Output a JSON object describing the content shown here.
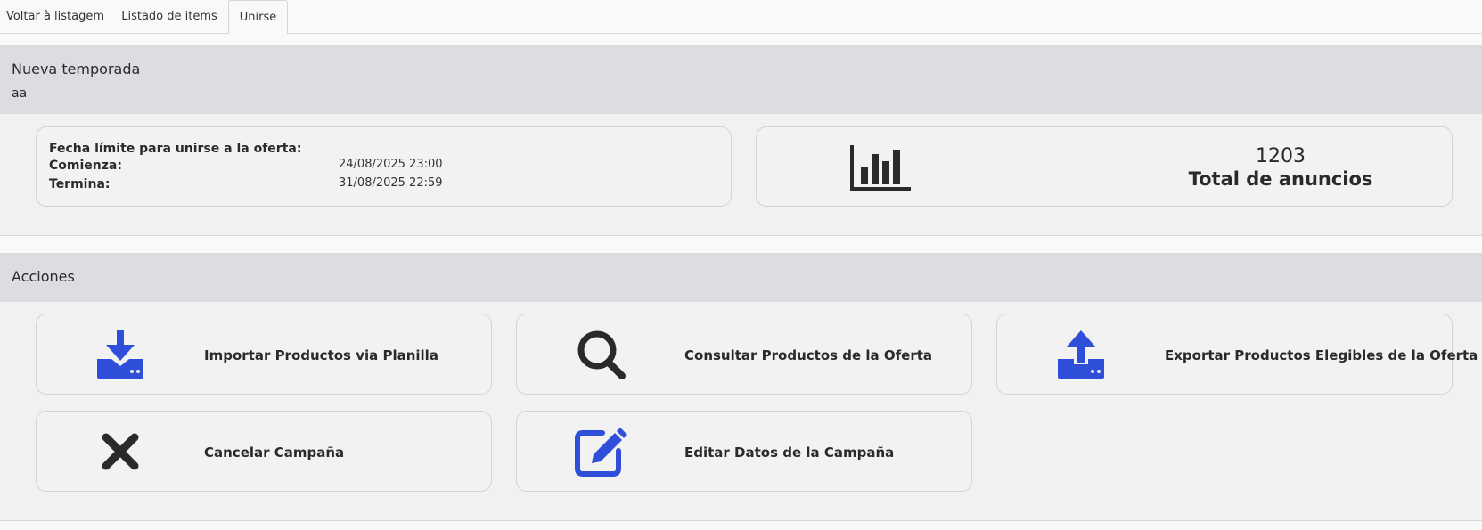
{
  "tabs": [
    {
      "label": "Voltar à listagem"
    },
    {
      "label": "Listado de items"
    },
    {
      "label": "Unirse"
    }
  ],
  "campaign": {
    "title": "Nueva temporada",
    "subtitle": "aa"
  },
  "dates": {
    "deadline_label": "Fecha límite para unirse a la oferta:",
    "start_label": "Comienza:",
    "start_value": "24/08/2025 23:00",
    "end_label": "Termina:",
    "end_value": "31/08/2025 22:59"
  },
  "stats": {
    "total_value": "1203",
    "total_label": "Total de anuncios",
    "icon": "bar-chart-icon"
  },
  "actions_section": {
    "title": "Acciones",
    "items": [
      {
        "label": "Importar Productos via Planilla",
        "icon": "download-tray-icon"
      },
      {
        "label": "Consultar Productos de la Oferta",
        "icon": "search-icon"
      },
      {
        "label": "Exportar Productos Elegibles de la Oferta",
        "icon": "upload-tray-icon"
      },
      {
        "label": "Cancelar Campaña",
        "icon": "close-icon"
      },
      {
        "label": "Editar Datos de la Campaña",
        "icon": "edit-icon"
      }
    ]
  },
  "colors": {
    "accent_blue": "#2f4fdb",
    "dark_icon": "#2a2a2a",
    "header_bg": "#dcdde0",
    "card_bg": "#f2f2f2"
  }
}
